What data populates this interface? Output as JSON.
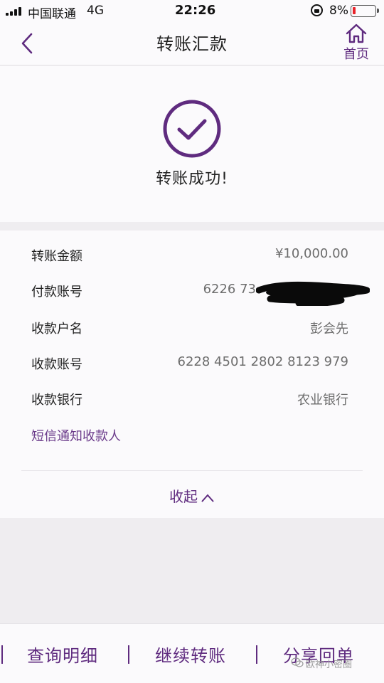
{
  "status_bar": {
    "carrier": "中国联通",
    "network": "4G",
    "time": "22:26",
    "battery_percent": "8%",
    "battery_color": "#e8232a"
  },
  "navbar": {
    "title": "转账汇款",
    "back_icon": "chevron-left-icon",
    "home_icon": "home-icon",
    "home_label": "首页"
  },
  "result": {
    "icon": "check-circle-icon",
    "message": "转账成功!"
  },
  "details": {
    "rows": [
      {
        "label": "转账金额",
        "value": "¥10,000.00"
      },
      {
        "label": "付款账号",
        "value": "6226 73"
      },
      {
        "label": "收款户名",
        "value": "彭会先"
      },
      {
        "label": "收款账号",
        "value": "6228 4501 2802 8123 979"
      },
      {
        "label": "收款银行",
        "value": "农业银行"
      }
    ],
    "sms_link": "短信通知收款人",
    "collapse_label": "收起"
  },
  "bottom_bar": {
    "buttons": [
      "查询明细",
      "继续转账",
      "分享回单"
    ],
    "watermark": "欧神小密圈"
  },
  "colors": {
    "accent": "#5f2b7f",
    "link": "#6a3a8a",
    "background": "#efedf0",
    "card": "#fbfafc"
  }
}
